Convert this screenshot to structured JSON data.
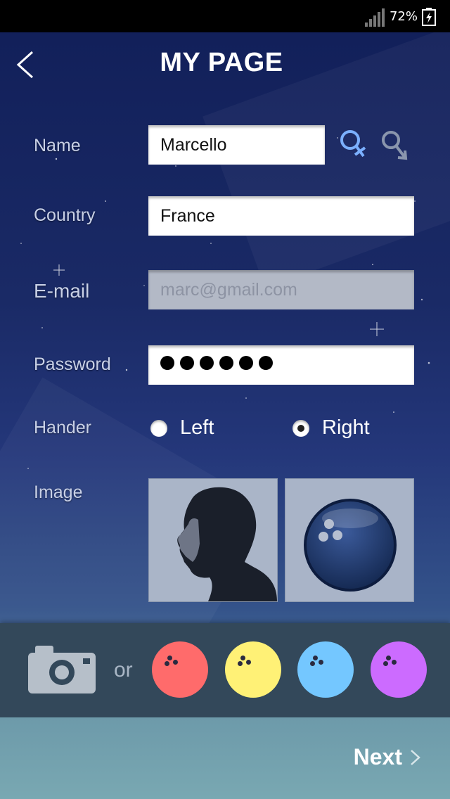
{
  "status_bar": {
    "battery_text": "72%",
    "signal_icon": "signal-bars-icon",
    "battery_icon": "battery-charging-icon"
  },
  "header": {
    "title": "MY PAGE",
    "back_icon": "chevron-left-icon"
  },
  "form": {
    "name": {
      "label": "Name",
      "value": "Marcello"
    },
    "gender": {
      "female_icon": "female-symbol-icon",
      "male_icon": "male-symbol-icon",
      "selected": "female"
    },
    "country": {
      "label": "Country",
      "value": "France"
    },
    "email": {
      "label": "E-mail",
      "value": "marc@gmail.com",
      "disabled": true
    },
    "password": {
      "label": "Password",
      "masked_length": 6
    },
    "hander": {
      "label": "Hander",
      "options": [
        "Left",
        "Right"
      ],
      "selected": "Right"
    },
    "image": {
      "label": "Image"
    }
  },
  "picker": {
    "camera_icon": "camera-icon",
    "or_text": "or",
    "ball_colors": [
      "#ff6b6b",
      "#fff176",
      "#74c7ff",
      "#cc6bff"
    ]
  },
  "footer": {
    "next_label": "Next",
    "next_icon": "chevron-right-icon"
  }
}
